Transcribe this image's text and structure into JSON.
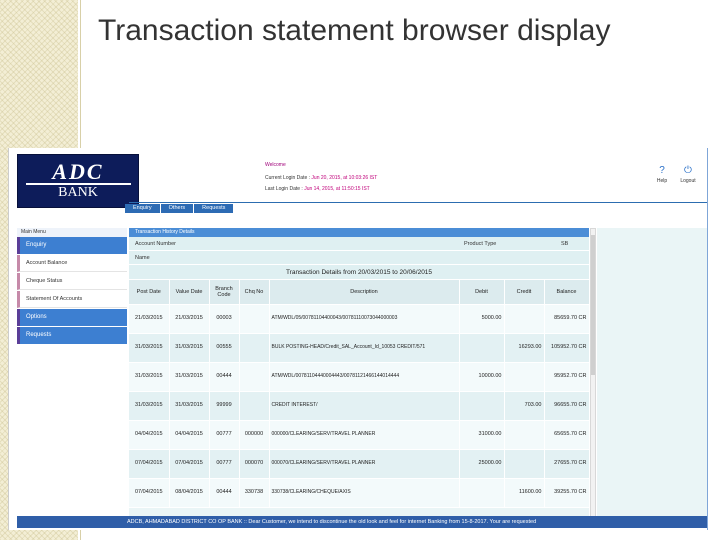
{
  "slide": {
    "title": "Transaction statement browser display"
  },
  "bank": {
    "logo_text": "ADC",
    "logo_subtext": "BANK",
    "welcome": "Welcome",
    "current_login_label": "Current Login Date",
    "current_login_value": "Jun 20, 2015, at 10:03:26 IST",
    "last_login_label": "Last Login Date",
    "last_login_value": "Jun 14, 2015, at 11:50:15 IST",
    "help_label": "Help",
    "logout_label": "Logout"
  },
  "topnav": {
    "tabs": [
      "Enquiry",
      "Others",
      "Requests"
    ]
  },
  "leftmenu": {
    "title": "Main Menu",
    "items": [
      {
        "label": "Enquiry",
        "type": "active"
      },
      {
        "label": "Account Balance",
        "type": "sub"
      },
      {
        "label": "Cheque Status",
        "type": "sub"
      },
      {
        "label": "Statement Of Accounts",
        "type": "sub"
      },
      {
        "label": "Options",
        "type": "active"
      },
      {
        "label": "Requests",
        "type": "active"
      }
    ]
  },
  "content": {
    "title": "Transaction History Details",
    "account_number_label": "Account Number",
    "product_type_label": "Product Type",
    "product_type_value": "SB",
    "name_label": "Name",
    "statement_range": "Transaction Details from 20/03/2015 to 20/06/2015",
    "columns": [
      "Post Date",
      "Value Date",
      "Branch Code",
      "Chq No",
      "Description",
      "Debit",
      "Credit",
      "Balance"
    ],
    "rows": [
      {
        "post_date": "21/03/2015",
        "value_date": "21/03/2015",
        "branch": "00003",
        "chq": "",
        "desc": "ATM/WDL/05/00781104400043/00781110073044000003",
        "debit": "5000.00",
        "credit": "",
        "balance": "85659.70 CR"
      },
      {
        "post_date": "31/03/2015",
        "value_date": "31/03/2015",
        "branch": "00555",
        "chq": "",
        "desc": "BULK POSTING-HEAD/Credit_SAL_Account_Id_10053 CREDIT/571",
        "debit": "",
        "credit": "16293.00",
        "balance": "105952.70 CR"
      },
      {
        "post_date": "31/03/2015",
        "value_date": "31/03/2015",
        "branch": "00444",
        "chq": "",
        "desc": "ATM/WDL/00781104440004443/00781121466144014444",
        "debit": "10000.00",
        "credit": "",
        "balance": "95952.70 CR"
      },
      {
        "post_date": "31/03/2015",
        "value_date": "31/03/2015",
        "branch": "99999",
        "chq": "",
        "desc": "CREDIT INTEREST/",
        "debit": "",
        "credit": "703.00",
        "balance": "96655.70 CR"
      },
      {
        "post_date": "04/04/2015",
        "value_date": "04/04/2015",
        "branch": "00777",
        "chq": "000000",
        "desc": "000000/CLEARING/SERV/TRAVEL PLANNER",
        "debit": "31000.00",
        "credit": "",
        "balance": "65655.70 CR"
      },
      {
        "post_date": "07/04/2015",
        "value_date": "07/04/2015",
        "branch": "00777",
        "chq": "000070",
        "desc": "000070/CLEARING/SERV/TRAVEL PLANNER",
        "debit": "25000.00",
        "credit": "",
        "balance": "27655.70 CR"
      },
      {
        "post_date": "07/04/2015",
        "value_date": "08/04/2015",
        "branch": "00444",
        "chq": "330738",
        "desc": "330738/CLEARING/CHEQUE/AXIS",
        "debit": "",
        "credit": "11600.00",
        "balance": "39255.70 CR"
      }
    ]
  },
  "ticker": {
    "text": "ADCB, AHMADABAD DISTRICT CO OP BANK  ::  Dear Customer,   we intend to discontinue the old look and feel for internet Banking from 15-8-2017. Your are requested"
  }
}
